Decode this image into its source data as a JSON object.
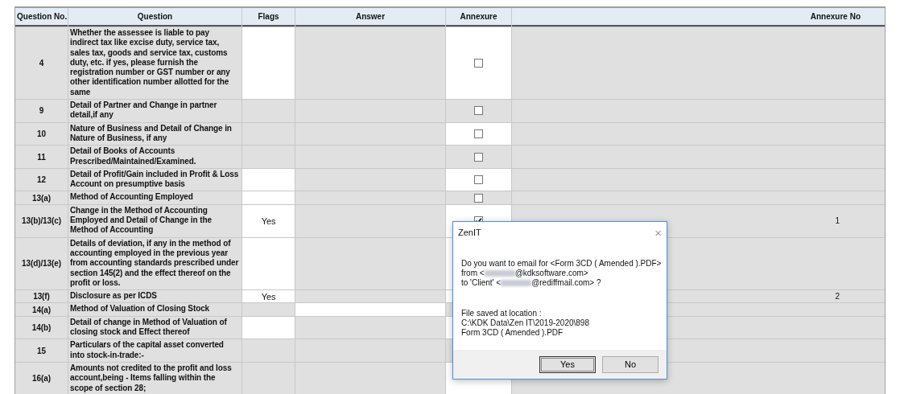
{
  "table": {
    "columns": [
      "Question No.",
      "Question",
      "Flags",
      "Answer",
      "Annexure",
      "Annexure No"
    ],
    "rows": [
      {
        "no": "4",
        "question": "Whether the assessee is liable to pay indirect tax like excise duty, service tax, sales tax, goods and service tax, customs duty, etc. if yes, please furnish the registration number or GST number or any other identification number allotted for the same",
        "flags_editable": true,
        "answer_editable": false,
        "annexure_editable": true,
        "annexure_checked": false
      },
      {
        "no": "9",
        "question": "Detail of Partner and Change in partner detail,if any",
        "flags_editable": false,
        "answer_editable": false,
        "annexure_editable": false,
        "annexure_checked": false
      },
      {
        "no": "10",
        "question": "Nature of Business and Detail of Change in Nature of Business, if any",
        "flags_editable": false,
        "answer_editable": false,
        "annexure_editable": true,
        "annexure_checked": false
      },
      {
        "no": "11",
        "question": "Detail of Books of Accounts Prescribed/Maintained/Examined.",
        "flags_editable": false,
        "answer_editable": false,
        "annexure_editable": false,
        "annexure_checked": false
      },
      {
        "no": "12",
        "question": "Detail of Profit/Gain included in Profit & Loss Account on presumptive basis",
        "flags_editable": true,
        "answer_editable": false,
        "annexure_editable": true,
        "annexure_checked": false
      },
      {
        "no": "13(a)",
        "question": "Method of Accounting Employed",
        "flags_editable": true,
        "answer_editable": false,
        "annexure_editable": false,
        "annexure_checked": false
      },
      {
        "no": "13(b)/13(c)",
        "question": "Change in the Method of Accounting Employed and Detail of Change in the Method of Accounting",
        "flags": "Yes",
        "flags_editable": true,
        "answer_editable": false,
        "annexure_editable": true,
        "annexure_checked": true,
        "annexure_no": "1"
      },
      {
        "no": "13(d)/13(e)",
        "question": "Details of deviation, if any in the method of accounting employed in the previous year from accounting standards prescribed under section 145(2) and the effect thereof on the profit or loss.",
        "flags_editable": true,
        "answer_editable": false,
        "annexure_editable": true
      },
      {
        "no": "13(f)",
        "question": "Disclosure as per ICDS",
        "flags": "Yes",
        "flags_editable": true,
        "answer_editable": false,
        "annexure_editable": true,
        "annexure_no": "2"
      },
      {
        "no": "14(a)",
        "question": "Method of Valuation of Closing Stock",
        "flags_editable": false,
        "answer_editable": true,
        "annexure_editable": false
      },
      {
        "no": "14(b)",
        "question": "Detail of change in Method of Valuation of closing stock and Effect thereof",
        "flags_editable": true,
        "answer_editable": false,
        "annexure_editable": true
      },
      {
        "no": "15",
        "question": "Particulars of the capital asset converted into stock-in-trade:-",
        "flags_editable": false,
        "answer_editable": false,
        "annexure_editable": false
      },
      {
        "no": "16(a)",
        "question": "Amounts not credited to the profit and loss account,being - Items falling within the scope of section 28;",
        "flags_editable": false,
        "answer_editable": false,
        "annexure_editable": true
      }
    ]
  },
  "dialog": {
    "title": "ZenIT",
    "close": "×",
    "message": [
      [
        {
          "kind": "text",
          "text": "Do you want to email for <Form 3CD ( Amended ).PDF>"
        }
      ],
      [
        {
          "kind": "text",
          "text": "from <"
        },
        {
          "kind": "redacted"
        },
        {
          "kind": "text",
          "text": "@kdksoftware.com>"
        }
      ],
      [
        {
          "kind": "text",
          "text": "to 'Client' <"
        },
        {
          "kind": "redacted"
        },
        {
          "kind": "text",
          "text": "@rediffmail.com> ?"
        }
      ]
    ],
    "location": [
      "File saved at location :",
      "C:\\KDK Data\\Zen IT\\2019-2020\\898",
      "Form 3CD ( Amended ).PDF"
    ],
    "buttons": [
      {
        "label": "Yes",
        "default": true
      },
      {
        "label": "No",
        "default": false
      }
    ]
  }
}
